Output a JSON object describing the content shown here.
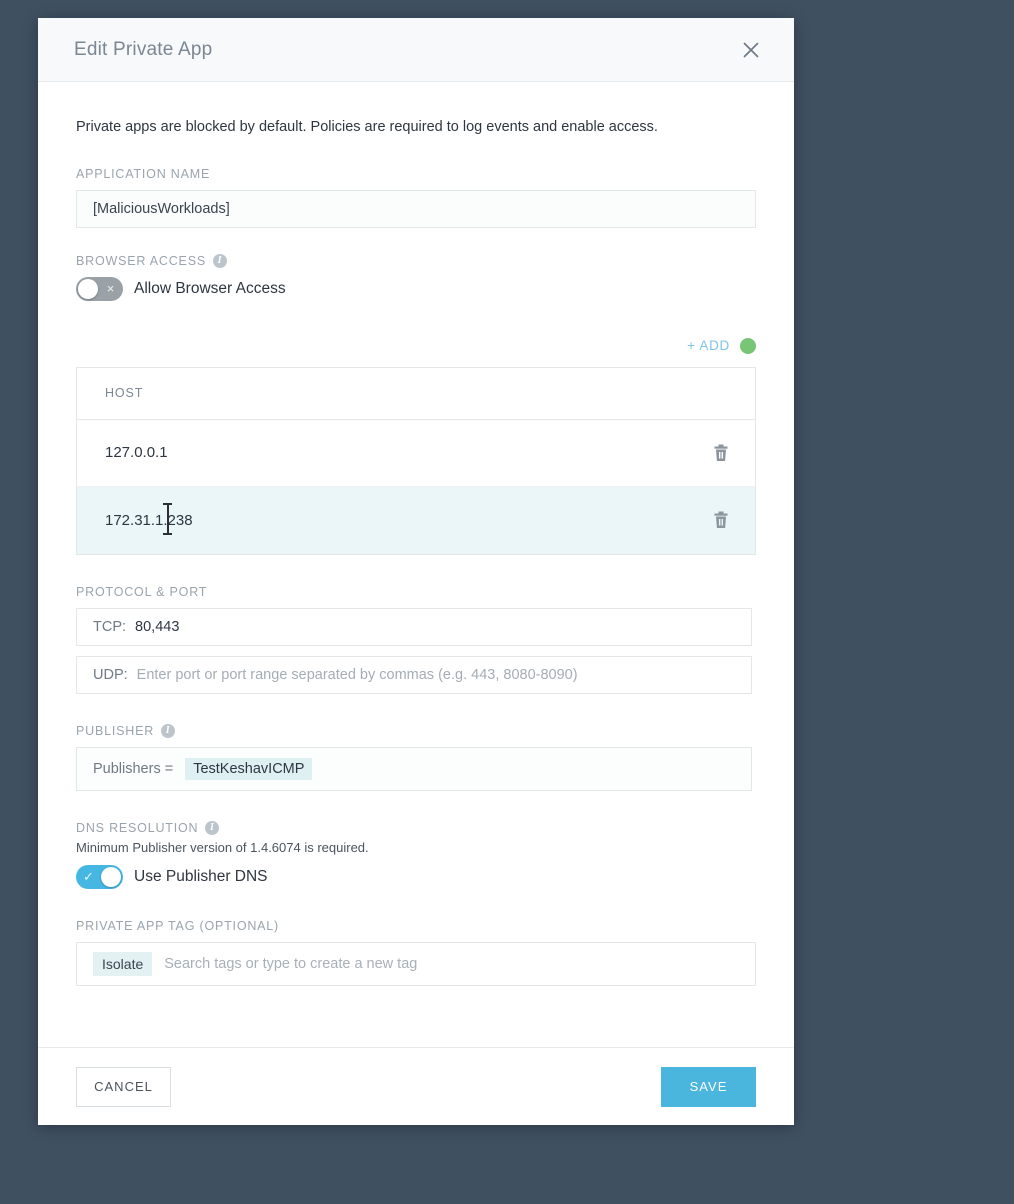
{
  "modal": {
    "title": "Edit Private App",
    "close_icon": "close-icon",
    "intro": "Private apps are blocked by default. Policies are required to log events and enable access."
  },
  "application_name": {
    "label": "APPLICATION NAME",
    "value": "[MaliciousWorkloads]"
  },
  "browser_access": {
    "label": "BROWSER ACCESS",
    "info_icon": "i",
    "toggle_label": "Allow Browser Access",
    "toggle_state": "off",
    "toggle_mark": "×"
  },
  "hosts": {
    "add_label": "+ ADD",
    "column_header": "HOST",
    "rows": [
      {
        "host": "127.0.0.1",
        "selected": false,
        "delete_icon": "trash-icon"
      },
      {
        "host": "172.31.1.238",
        "selected": true,
        "delete_icon": "trash-icon"
      }
    ]
  },
  "protocol_port": {
    "label": "PROTOCOL & PORT",
    "tcp_prefix": "TCP:",
    "tcp_value": "80,443",
    "udp_prefix": "UDP:",
    "udp_placeholder": "Enter port or port range separated by commas (e.g. 443, 8080-8090)"
  },
  "publisher": {
    "label": "PUBLISHER",
    "info_icon": "i",
    "prefix": "Publishers =",
    "chip": "TestKeshavICMP"
  },
  "dns_resolution": {
    "label": "DNS RESOLUTION",
    "info_icon": "i",
    "hint": "Minimum Publisher version of 1.4.6074 is required.",
    "toggle_label": "Use Publisher DNS",
    "toggle_state": "on",
    "toggle_mark": "✓"
  },
  "private_app_tag": {
    "label": "PRIVATE APP TAG (OPTIONAL)",
    "chip": "Isolate",
    "placeholder": "Search tags or type to create a new tag"
  },
  "footer": {
    "cancel_label": "CANCEL",
    "save_label": "SAVE"
  },
  "colors": {
    "page_background": "#3f5061",
    "accent_blue": "#4ab5dd",
    "toggle_on": "#46b7e3",
    "toggle_off": "#9aa1a7",
    "add_link": "#7fc3e8",
    "cursor_dot_green": "#78c576",
    "row_selected": "#eaf6f8",
    "chip_background": "#dff0f3"
  }
}
